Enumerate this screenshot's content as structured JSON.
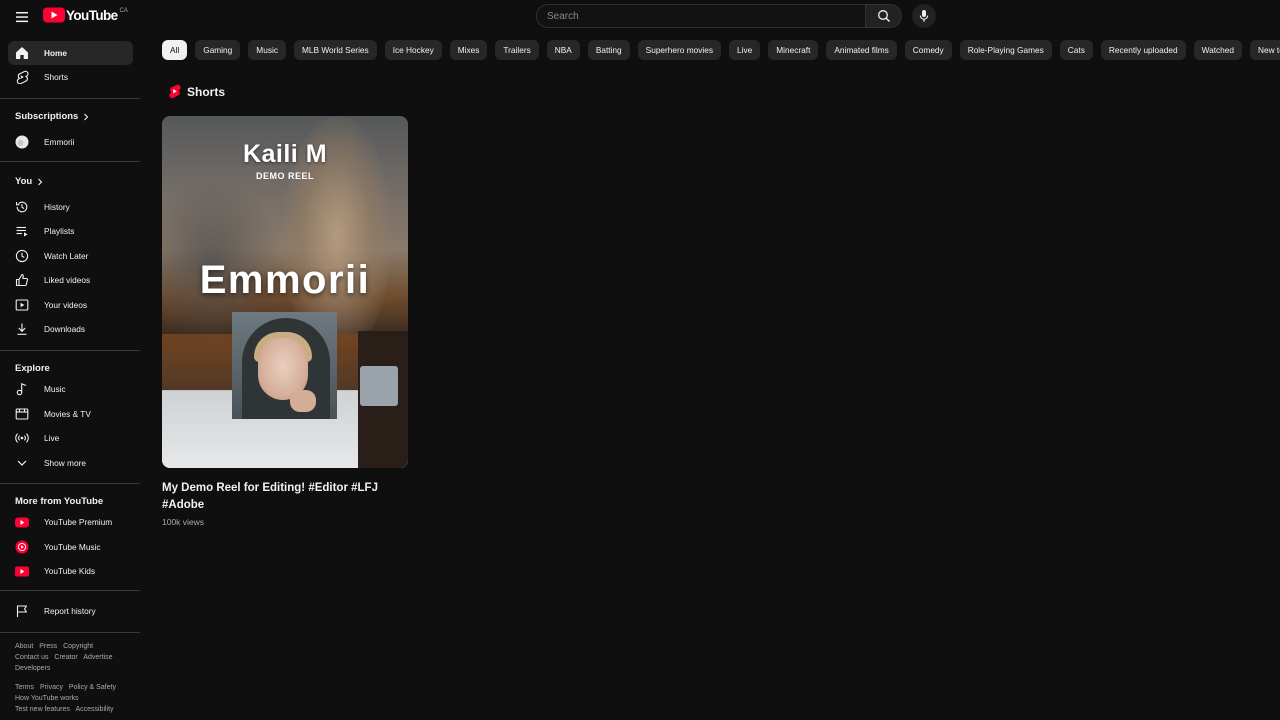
{
  "header": {
    "logo_text": "YouTube",
    "region": "CA",
    "search_placeholder": "Search"
  },
  "sidebar": {
    "main": [
      {
        "label": "Home",
        "icon": "home-icon",
        "active": true
      },
      {
        "label": "Shorts",
        "icon": "shorts-icon",
        "active": false
      }
    ],
    "subscriptions_header": "Subscriptions",
    "subscriptions": [
      {
        "label": "Emmorii",
        "icon": "channel-avatar"
      }
    ],
    "you_header": "You",
    "you": [
      {
        "label": "History",
        "icon": "history-icon"
      },
      {
        "label": "Playlists",
        "icon": "playlists-icon"
      },
      {
        "label": "Watch Later",
        "icon": "clock-icon"
      },
      {
        "label": "Liked videos",
        "icon": "thumbs-up-icon"
      },
      {
        "label": "Your videos",
        "icon": "play-square-icon"
      },
      {
        "label": "Downloads",
        "icon": "download-icon"
      }
    ],
    "explore_header": "Explore",
    "explore": [
      {
        "label": "Music",
        "icon": "music-note-icon"
      },
      {
        "label": "Movies & TV",
        "icon": "film-icon"
      },
      {
        "label": "Live",
        "icon": "live-icon"
      },
      {
        "label": "Show more",
        "icon": "chevron-down-icon"
      }
    ],
    "more_header": "More from YouTube",
    "more": [
      {
        "label": "YouTube Premium",
        "icon": "youtube-premium-icon"
      },
      {
        "label": "YouTube Music",
        "icon": "youtube-music-icon"
      },
      {
        "label": "YouTube Kids",
        "icon": "youtube-kids-icon"
      }
    ],
    "report_history": "Report history",
    "footer": {
      "line1": [
        "About",
        "Press",
        "Copyright"
      ],
      "line2": [
        "Contact us",
        "Creator",
        "Advertise"
      ],
      "line3": [
        "Developers"
      ],
      "line4": [
        "Terms",
        "Privacy",
        "Policy & Safety"
      ],
      "line5": [
        "How YouTube works"
      ],
      "line6": [
        "Test new features",
        "Accessibility"
      ]
    }
  },
  "chips": [
    "All",
    "Gaming",
    "Music",
    "MLB World Series",
    "Ice Hockey",
    "Mixes",
    "Trailers",
    "NBA",
    "Batting",
    "Superhero movies",
    "Live",
    "Minecraft",
    "Animated films",
    "Comedy",
    "Role-Playing Games",
    "Cats",
    "Recently uploaded",
    "Watched",
    "New to you"
  ],
  "shorts_shelf": {
    "title": "Shorts",
    "items": [
      {
        "thumb_name": "Kaili M",
        "thumb_sub": "DEMO REEL",
        "thumb_big": "Emmorii",
        "title": "My Demo Reel for Editing! #Editor #LFJ #Adobe",
        "views": "100k views"
      }
    ]
  },
  "colors": {
    "background": "#0f0f0f",
    "brand_red": "#ff0033",
    "chip_bg": "#272727",
    "chip_active_bg": "#f1f1f1"
  }
}
